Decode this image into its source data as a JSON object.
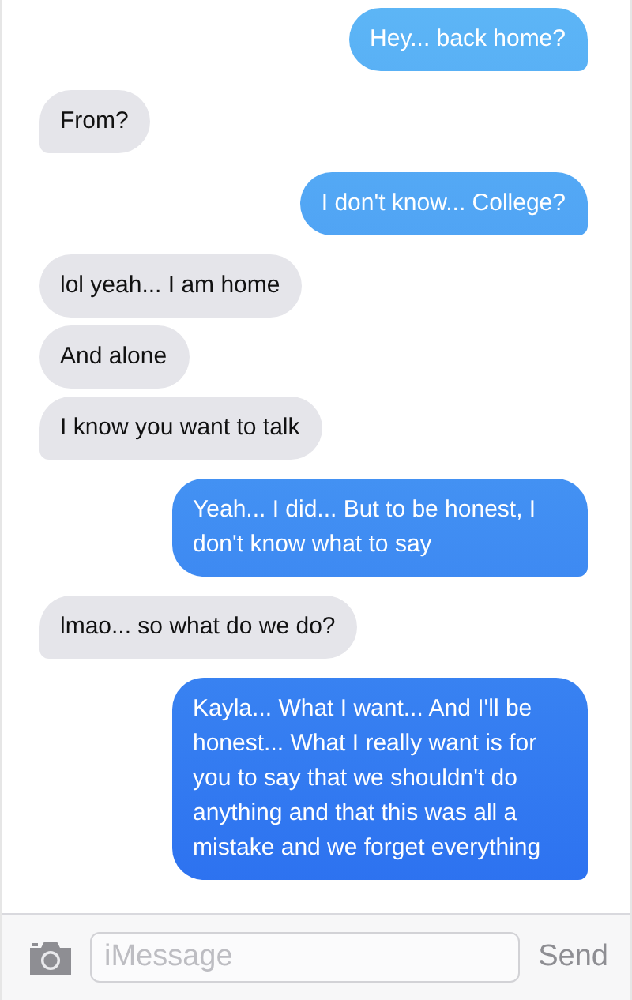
{
  "messages": [
    {
      "kind": "sent",
      "text": "Hey... back home?"
    },
    {
      "kind": "received",
      "text": "From?"
    },
    {
      "kind": "sent",
      "text": "I don't know... College?"
    },
    {
      "kind": "received",
      "text": "lol yeah... I am home"
    },
    {
      "kind": "received",
      "text": "And alone"
    },
    {
      "kind": "received",
      "text": "I know you want to talk"
    },
    {
      "kind": "sent",
      "text": "Yeah... I did... But to be honest, I don't know what to say"
    },
    {
      "kind": "received",
      "text": "lmao... so what do we do?"
    },
    {
      "kind": "sent",
      "text": "Kayla... What I want... And I'll be honest... What I really want is for you to say that we shouldn't do anything and that this was all a mistake and we forget everything"
    }
  ],
  "composer": {
    "placeholder": "iMessage",
    "send_label": "Send"
  }
}
